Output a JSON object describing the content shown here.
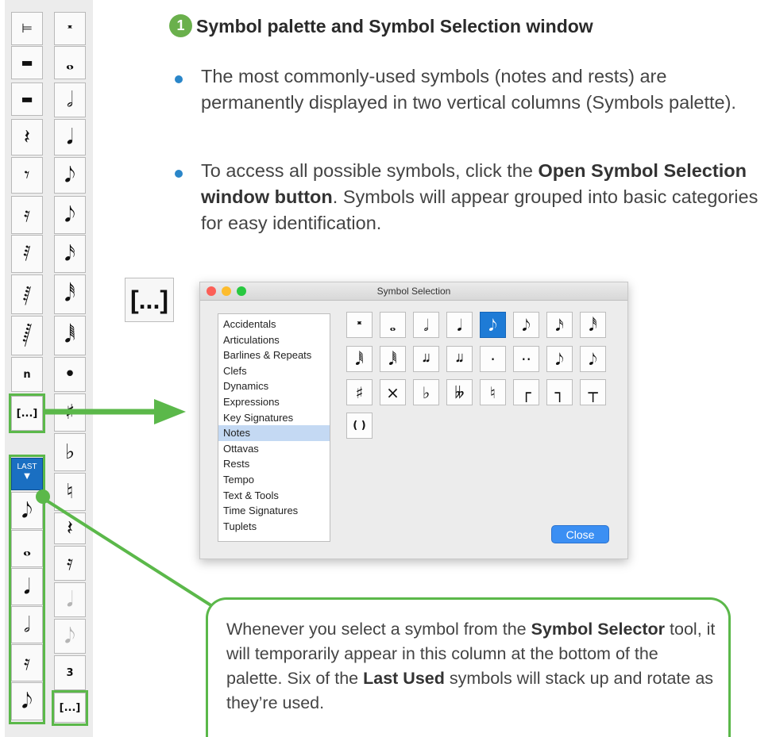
{
  "heading": {
    "number": "1",
    "title": "Symbol palette and Symbol Selection window"
  },
  "paragraphs": [
    {
      "text": "The most commonly-used symbols (notes and rests) are permanently displayed in two vertical columns (Symbols palette)."
    },
    {
      "before": "To access all possible symbols, click the ",
      "bold": "Open Symbol Selection window button",
      "after": ". Symbols will appear grouped into basic categories for easy identification."
    }
  ],
  "big_button": {
    "label": "[...]"
  },
  "palette": {
    "left_column": [
      "⊨",
      "▬",
      "▬",
      "𝄽",
      "𝄾",
      "𝄿",
      "𝅀",
      "𝅁",
      "𝅂",
      "n",
      "[...]"
    ],
    "right_column": [
      "𝄺",
      "𝅝",
      "𝅗𝅥",
      "𝅘𝅥",
      "𝅘𝅥𝅮",
      "𝅘𝅥𝅮",
      "𝅘𝅥𝅯",
      "𝅘𝅥𝅰",
      "𝅘𝅥𝅱",
      "•",
      "♯",
      "♭",
      "♮",
      "𝄽",
      "𝄿",
      "𝅘𝅥",
      "𝅘𝅥𝅮",
      "3",
      "[...]"
    ],
    "last_button_label": "LAST",
    "last_used": [
      "𝅘𝅥𝅮",
      "𝅝",
      "𝅘𝅥",
      "𝅗𝅥",
      "𝄿",
      "𝅘𝅥𝅮"
    ]
  },
  "window": {
    "title": "Symbol Selection",
    "categories": [
      "Accidentals",
      "Articulations",
      "Barlines & Repeats",
      "Clefs",
      "Dynamics",
      "Expressions",
      "Key Signatures",
      "Notes",
      "Ottavas",
      "Rests",
      "Tempo",
      "Text & Tools",
      "Time Signatures",
      "Tuplets"
    ],
    "selected_category": "Notes",
    "symbols": [
      "𝄺",
      "𝅝",
      "𝅗𝅥",
      "𝅘𝅥",
      "𝅘𝅥𝅮",
      "𝅘𝅥𝅮",
      "𝅘𝅥𝅯",
      "𝅘𝅥𝅰",
      "𝅘𝅥𝅱",
      "𝅘𝅥𝅱",
      "𝅘𝅥𝅘𝅥",
      "𝅘𝅥𝅘𝅥",
      "·",
      "··",
      "𝅘𝅥𝅮",
      "𝅘𝅥𝅮",
      "♯",
      "×",
      "♭",
      "𝄫",
      "♮",
      "┌",
      "┐",
      "┬",
      "( )"
    ],
    "selected_symbol": "𝅘𝅥𝅮",
    "close_label": "Close"
  },
  "callout": {
    "p1": "Whenever you select a symbol from the ",
    "b1": "Symbol Selector",
    "p2": " tool, it will temporarily appear in this column at the bottom of the palette. Six of the ",
    "b2": "Last Used",
    "p3": " symbols will stack up and rotate as they’re used."
  },
  "colors": {
    "accent_green": "#5bb84a",
    "bullet_blue": "#2a86c9",
    "selection_blue": "#1e7bd6"
  }
}
